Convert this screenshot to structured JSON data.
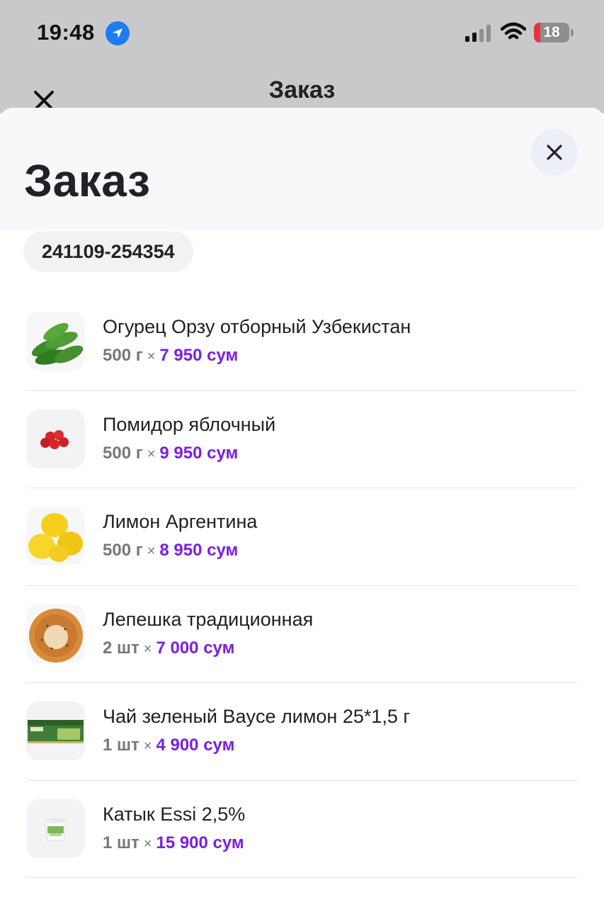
{
  "status_bar": {
    "time": "19:48",
    "battery": "18",
    "battery_level": 0.18,
    "icons": [
      "location-arrow-icon",
      "cellular-signal-icon",
      "wifi-icon",
      "battery-icon"
    ]
  },
  "background_screen": {
    "title": "Заказ"
  },
  "sheet": {
    "title": "Заказ",
    "order_number": "241109-254354"
  },
  "items": [
    {
      "name": "Огурец Орзу отборный Узбекистан",
      "qty": "500 г",
      "times": "×",
      "price": "7 950 сум",
      "thumb": "cucumbers"
    },
    {
      "name": "Помидор яблочный",
      "qty": "500 г",
      "times": "×",
      "price": "9 950 сум",
      "thumb": "tomatoes"
    },
    {
      "name": "Лимон Аргентина",
      "qty": "500 г",
      "times": "×",
      "price": "8 950 сум",
      "thumb": "lemons"
    },
    {
      "name": "Лепешка традиционная",
      "qty": "2 шт",
      "times": "×",
      "price": "7 000 сум",
      "thumb": "flatbread"
    },
    {
      "name": "Чай зеленый Bayce лимон 25*1,5 г",
      "qty": "1 шт",
      "times": "×",
      "price": "4 900 сум",
      "thumb": "tea-box"
    },
    {
      "name": "Катык Essi 2,5%",
      "qty": "1 шт",
      "times": "×",
      "price": "15 900 сум",
      "thumb": "yogurt-cup"
    }
  ],
  "colors": {
    "price": "#7a1fe0",
    "location_icon": "#1d7cf2",
    "battery_low": "#e8323b"
  }
}
